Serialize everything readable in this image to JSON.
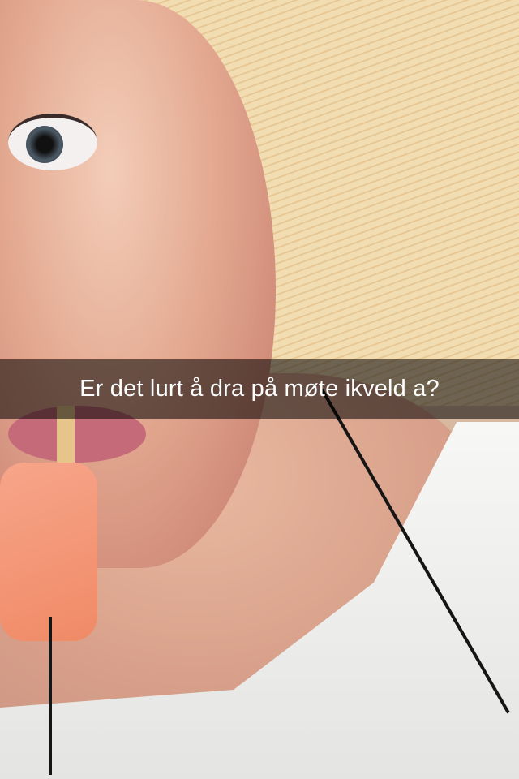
{
  "caption": {
    "text": "Er det lurt å dra på møte ikveld a?"
  }
}
